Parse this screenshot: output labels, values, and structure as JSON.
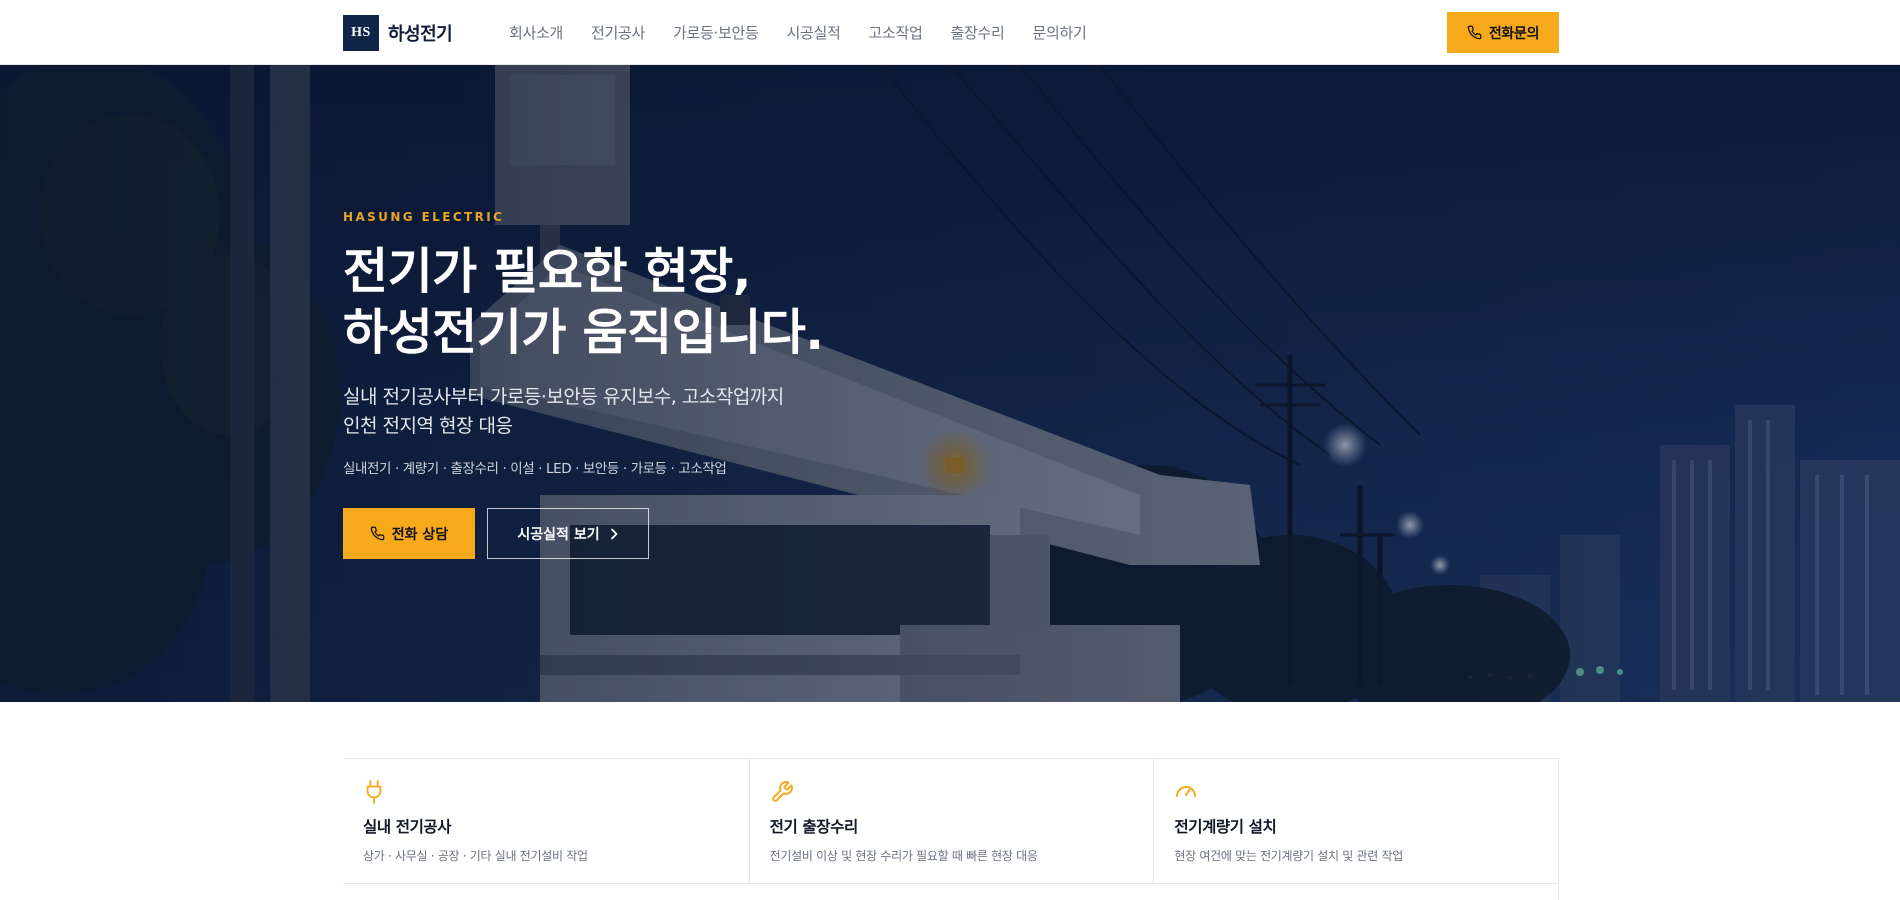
{
  "header": {
    "logo_mark": "HS",
    "logo_text": "하성전기",
    "nav": [
      "회사소개",
      "전기공사",
      "가로등·보안등",
      "시공실적",
      "고소작업",
      "출장수리",
      "문의하기"
    ],
    "call_label": "전화문의"
  },
  "hero": {
    "eyebrow": "HASUNG ELECTRIC",
    "title_line1": "전기가 필요한 현장,",
    "title_line2": "하성전기가 움직입니다.",
    "sub_line1": "실내 전기공사부터 가로등·보안등 유지보수, 고소작업까지",
    "sub_line2": "인천 전지역 현장 대응",
    "tags": "실내전기 · 계량기 · 출장수리 · 이설 · LED · 보안등 · 가로등 · 고소작업",
    "primary_label": "전화 상담",
    "secondary_label": "시공실적 보기"
  },
  "services": [
    {
      "icon": "plug-icon",
      "title": "실내 전기공사",
      "desc": "상가 · 사무실 · 공장 · 기타 실내 전기설비 작업"
    },
    {
      "icon": "wrench-icon",
      "title": "전기 출장수리",
      "desc": "전기설비 이상 및 현장 수리가 필요할 때 빠른 현장 대응"
    },
    {
      "icon": "gauge-icon",
      "title": "전기계량기 설치",
      "desc": "현장 여건에 맞는 전기계량기 설치 및 관련 작업"
    }
  ],
  "colors": {
    "accent": "#f5a91b",
    "navy": "#0f2547",
    "hero_overlay": "#0e1c38"
  }
}
